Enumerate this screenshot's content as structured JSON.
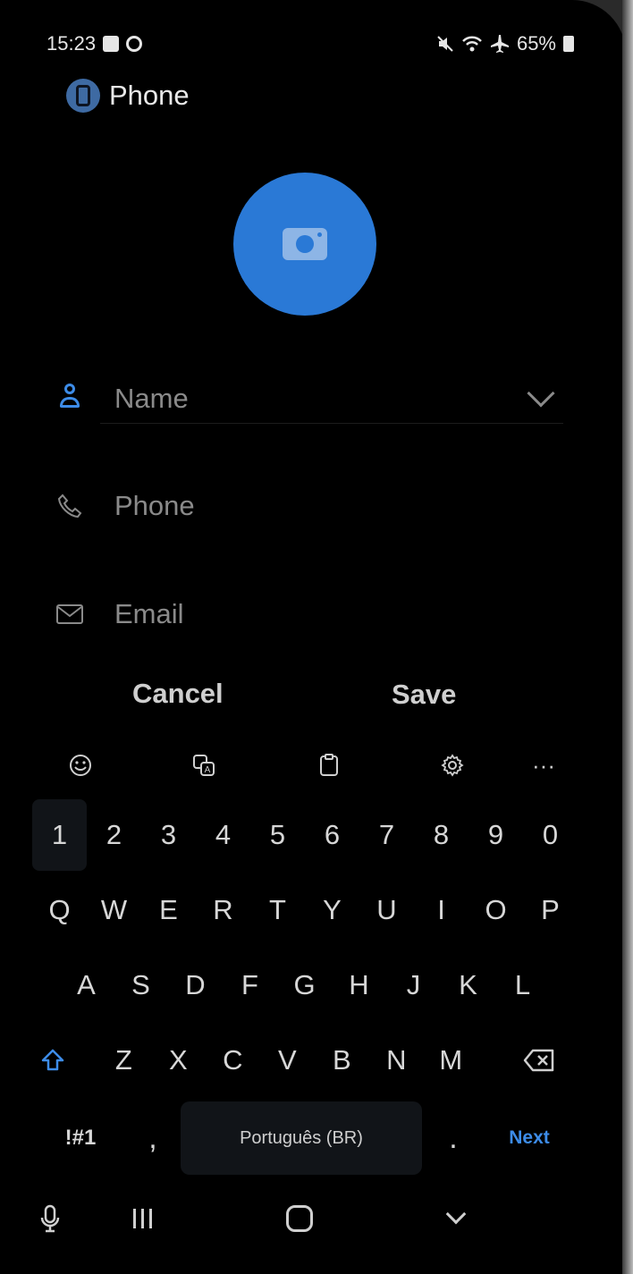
{
  "status_bar": {
    "time": "15:23",
    "battery": "65%",
    "icons": [
      "notification-box-icon",
      "notification-circle-icon",
      "mute-icon",
      "wifi-icon",
      "airplane-icon",
      "battery-icon"
    ]
  },
  "app": {
    "title": "Phone",
    "icon": "phone-app-icon"
  },
  "contact_form": {
    "avatar_icon": "camera-icon",
    "avatar_color": "#2a79d6",
    "name_placeholder": "Name",
    "phone_placeholder": "Phone",
    "email_placeholder": "Email"
  },
  "actions": {
    "cancel_label": "Cancel",
    "save_label": "Save"
  },
  "keyboard_toolbar": {
    "items": [
      "emoji-icon",
      "translate-icon",
      "clipboard-icon",
      "settings-icon",
      "more-icon"
    ],
    "more_label": "···"
  },
  "keyboard": {
    "number_row": [
      "1",
      "2",
      "3",
      "4",
      "5",
      "6",
      "7",
      "8",
      "9",
      "0"
    ],
    "row1": [
      "Q",
      "W",
      "E",
      "R",
      "T",
      "Y",
      "U",
      "I",
      "O",
      "P"
    ],
    "row2": [
      "A",
      "S",
      "D",
      "F",
      "G",
      "H",
      "J",
      "K",
      "L"
    ],
    "row3": [
      "Z",
      "X",
      "C",
      "V",
      "B",
      "N",
      "M"
    ],
    "symbols_label": "!#1",
    "comma": ",",
    "space_label": "Português (BR)",
    "period": ".",
    "next_label": "Next",
    "accent_color": "#3d8ce8"
  },
  "nav_bar": {
    "items": [
      "mic-icon",
      "recents-icon",
      "home-icon",
      "hide-keyboard-icon"
    ]
  }
}
